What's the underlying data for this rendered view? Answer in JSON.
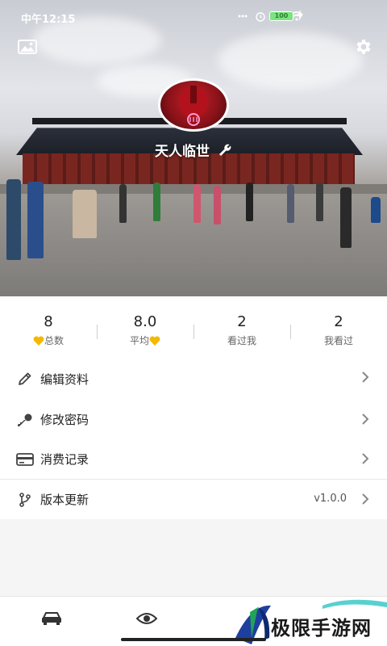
{
  "status_bar": {
    "time": "中午12:15",
    "battery": "100"
  },
  "profile": {
    "username": "天人临世"
  },
  "stats": [
    {
      "value": "8",
      "label": "总数",
      "heart": "before"
    },
    {
      "value": "8.0",
      "label": "平均",
      "heart": "after"
    },
    {
      "value": "2",
      "label": "看过我",
      "heart": "none"
    },
    {
      "value": "2",
      "label": "我看过",
      "heart": "none"
    }
  ],
  "menu": {
    "edit_profile": "编辑资料",
    "change_password": "修改密码",
    "consumption_record": "消费记录",
    "version_update": "版本更新",
    "version_value": "v1.0.0"
  },
  "watermark": {
    "text": "极限手游网"
  },
  "colors": {
    "heart": "#f5b800",
    "icon": "#444444",
    "chevron": "#888888"
  },
  "icons": {
    "top_left": "image-icon",
    "top_right": "gear-icon",
    "username_edit": "wrench-icon",
    "tab_1": "car-icon",
    "tab_2": "eye-icon"
  }
}
